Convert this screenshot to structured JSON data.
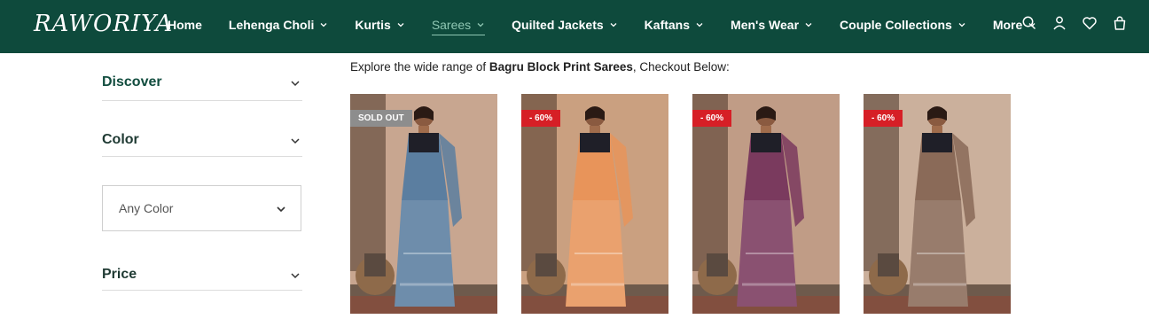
{
  "header": {
    "logo": "RAWORIYA",
    "nav": [
      {
        "label": "Home",
        "has_dropdown": false,
        "active": false
      },
      {
        "label": "Lehenga Choli",
        "has_dropdown": true,
        "active": false
      },
      {
        "label": "Kurtis",
        "has_dropdown": true,
        "active": false
      },
      {
        "label": "Sarees",
        "has_dropdown": true,
        "active": true
      },
      {
        "label": "Quilted Jackets",
        "has_dropdown": true,
        "active": false
      },
      {
        "label": "Kaftans",
        "has_dropdown": true,
        "active": false
      },
      {
        "label": "Men's Wear",
        "has_dropdown": true,
        "active": false
      },
      {
        "label": "Couple Collections",
        "has_dropdown": true,
        "active": false
      },
      {
        "label": "More",
        "has_dropdown": true,
        "active": false
      }
    ],
    "icons": [
      "search-icon",
      "account-icon",
      "wishlist-icon",
      "cart-icon"
    ],
    "bg_color": "#0e4a3c",
    "active_color": "#8fc7b3"
  },
  "sidebar": {
    "filters": [
      {
        "label": "Discover"
      },
      {
        "label": "Color"
      },
      {
        "label": "Price"
      }
    ],
    "color_select": {
      "value": "Any Color"
    }
  },
  "main": {
    "intro_prefix": "Explore the wide range of ",
    "intro_bold": "Bagru Block Print Sarees",
    "intro_suffix": ", Checkout Below:",
    "products": [
      {
        "badge": "SOLD OUT",
        "badge_type": "sold",
        "saree_color": "#5b7ea0"
      },
      {
        "badge": "- 60%",
        "badge_type": "sale",
        "saree_color": "#e8945a"
      },
      {
        "badge": "- 60%",
        "badge_type": "sale",
        "saree_color": "#7a3a5e"
      },
      {
        "badge": "- 60%",
        "badge_type": "sale",
        "saree_color": "#8a6a58"
      }
    ]
  }
}
